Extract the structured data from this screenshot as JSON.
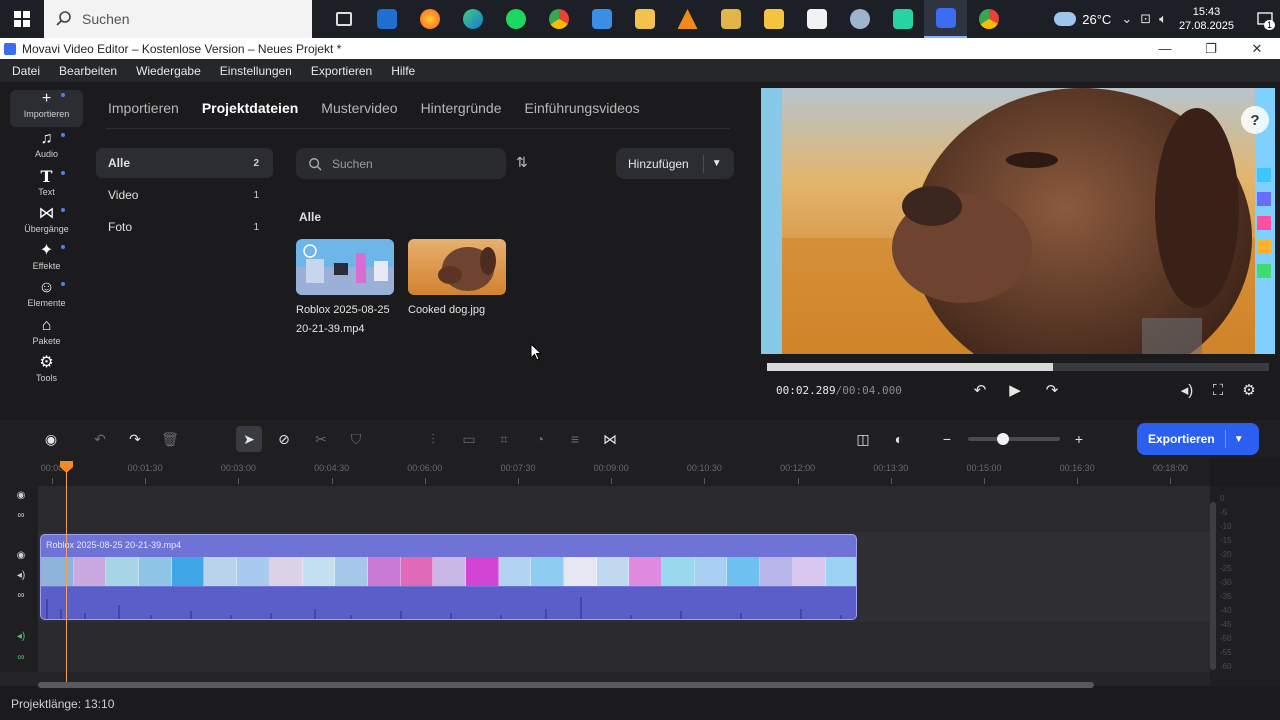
{
  "taskbar": {
    "search_placeholder": "Suchen",
    "weather": "26°C",
    "time": "15:43",
    "date": "27.08.2025",
    "notification_count": "1"
  },
  "window": {
    "title": "Movavi Video Editor – Kostenlose Version – Neues Projekt *"
  },
  "menu": [
    "Datei",
    "Bearbeiten",
    "Wiedergabe",
    "Einstellungen",
    "Exportieren",
    "Hilfe"
  ],
  "rail": [
    {
      "label": "Importieren",
      "icon": "plus-icon"
    },
    {
      "label": "Audio",
      "icon": "music-icon"
    },
    {
      "label": "Text",
      "icon": "text-icon"
    },
    {
      "label": "Übergänge",
      "icon": "transitions-icon"
    },
    {
      "label": "Effekte",
      "icon": "sparkle-icon"
    },
    {
      "label": "Elemente",
      "icon": "sticker-icon"
    },
    {
      "label": "Pakete",
      "icon": "package-icon"
    },
    {
      "label": "Tools",
      "icon": "tools-icon"
    }
  ],
  "media": {
    "tabs": [
      "Importieren",
      "Projektdateien",
      "Mustervideo",
      "Hintergründe",
      "Einführungsvideos"
    ],
    "selected_tab": "Projektdateien",
    "categories": [
      {
        "label": "Alle",
        "count": "2"
      },
      {
        "label": "Video",
        "count": "1"
      },
      {
        "label": "Foto",
        "count": "1"
      }
    ],
    "search_placeholder": "Suchen",
    "add_button": "Hinzufügen",
    "section_label": "Alle",
    "files": [
      {
        "name": "Roblox 2025-08-25 20-21-39.mp4"
      },
      {
        "name": "Cooked dog.jpg"
      }
    ]
  },
  "preview": {
    "current_time": "00:02.289",
    "total_time": "/00:04.000",
    "progress": 0.57
  },
  "timeline": {
    "export_button": "Exportieren",
    "zoom_level": 0.38,
    "ruler": [
      "00:00",
      "00:01:30",
      "00:03:00",
      "00:04:30",
      "00:06:00",
      "00:07:30",
      "00:09:00",
      "00:10:30",
      "00:12:00",
      "00:13:30",
      "00:15:00",
      "00:16:30",
      "00:18:00"
    ],
    "clip_name": "Roblox 2025-08-25 20-21-39.mp4",
    "db_scale": [
      "0",
      "-5",
      "-10",
      "-15",
      "-20",
      "-25",
      "-30",
      "-35",
      "-40",
      "-45",
      "-50",
      "-55",
      "-60"
    ]
  },
  "status": {
    "project_length": "Projektlänge: 13:10"
  }
}
